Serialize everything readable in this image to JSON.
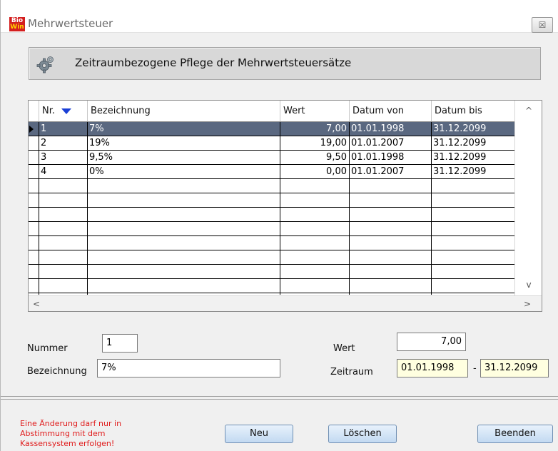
{
  "window": {
    "title": "Mehrwertsteuer",
    "app_icon_line1": "Bio",
    "app_icon_line2": "Win",
    "close_glyph": "☒"
  },
  "header": {
    "text": "Zeitraumbezogene Pflege der Mehrwertsteuersätze",
    "icon": "gear-icon"
  },
  "table": {
    "columns": [
      "Nr.",
      "Bezeichnung",
      "Wert",
      "Datum von",
      "Datum bis"
    ],
    "sort_column": "Nr.",
    "rows": [
      {
        "nr": "1",
        "bezeichnung": "7%",
        "wert": "7,00",
        "datum_von": "01.01.1998",
        "datum_bis": "31.12.2099",
        "selected": true
      },
      {
        "nr": "2",
        "bezeichnung": "19%",
        "wert": "19,00",
        "datum_von": "01.01.2007",
        "datum_bis": "31.12.2099",
        "selected": false
      },
      {
        "nr": "3",
        "bezeichnung": "9,5%",
        "wert": "9,50",
        "datum_von": "01.01.1998",
        "datum_bis": "31.12.2099",
        "selected": false
      },
      {
        "nr": "4",
        "bezeichnung": "0%",
        "wert": "0,00",
        "datum_von": "01.01.2007",
        "datum_bis": "31.12.2099",
        "selected": false
      }
    ],
    "scroll_up": "^",
    "scroll_down": "v",
    "scroll_left": "<",
    "scroll_right": ">"
  },
  "form": {
    "nummer_label": "Nummer",
    "nummer_value": "1",
    "bezeichnung_label": "Bezeichnung",
    "bezeichnung_value": "7%",
    "wert_label": "Wert",
    "wert_value": "7,00",
    "zeitraum_label": "Zeitraum",
    "zeitraum_von": "01.01.1998",
    "zeitraum_sep": "-",
    "zeitraum_bis": "31.12.2099"
  },
  "footer": {
    "warning": "Eine Änderung darf nur in Abstimmung mit dem Kassensystem erfolgen!",
    "buttons": {
      "neu": "Neu",
      "loeschen": "Löschen",
      "beenden": "Beenden"
    }
  },
  "colors": {
    "selection": "#5a6880",
    "warning": "#e01b1b",
    "sort_arrow": "#1a3fd6",
    "date_field_bg": "#ffffe0"
  }
}
